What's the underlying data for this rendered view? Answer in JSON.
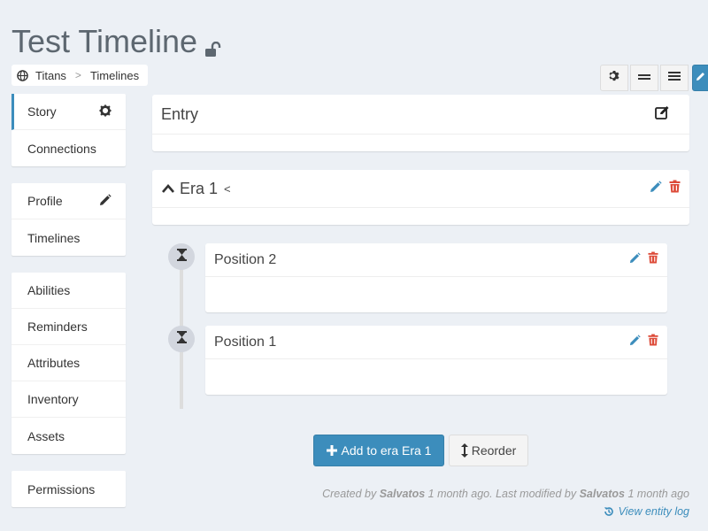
{
  "page": {
    "title": "Test Timeline"
  },
  "breadcrumb": {
    "items": [
      "Titans",
      "Timelines"
    ],
    "separator": ">"
  },
  "sidebar": {
    "groups": [
      [
        "Story",
        "Connections"
      ],
      [
        "Profile",
        "Timelines"
      ],
      [
        "Abilities",
        "Reminders",
        "Attributes",
        "Inventory",
        "Assets"
      ],
      [
        "Permissions"
      ]
    ]
  },
  "entry": {
    "title": "Entry"
  },
  "era": {
    "title": "Era 1",
    "marker": "<"
  },
  "positions": [
    {
      "title": "Position 2"
    },
    {
      "title": "Position 1"
    }
  ],
  "actions": {
    "add_label": "Add to era Era 1",
    "reorder_label": "Reorder"
  },
  "footer": {
    "created_prefix": "Created by",
    "created_by": "Salvatos",
    "created_when": "1 month ago. Last modified by",
    "modified_by": "Salvatos",
    "modified_when": "1 month ago",
    "log_label": "View entity log"
  },
  "colors": {
    "accent": "#3c8dbc",
    "danger": "#dd4b39",
    "background": "#ecf0f5"
  }
}
